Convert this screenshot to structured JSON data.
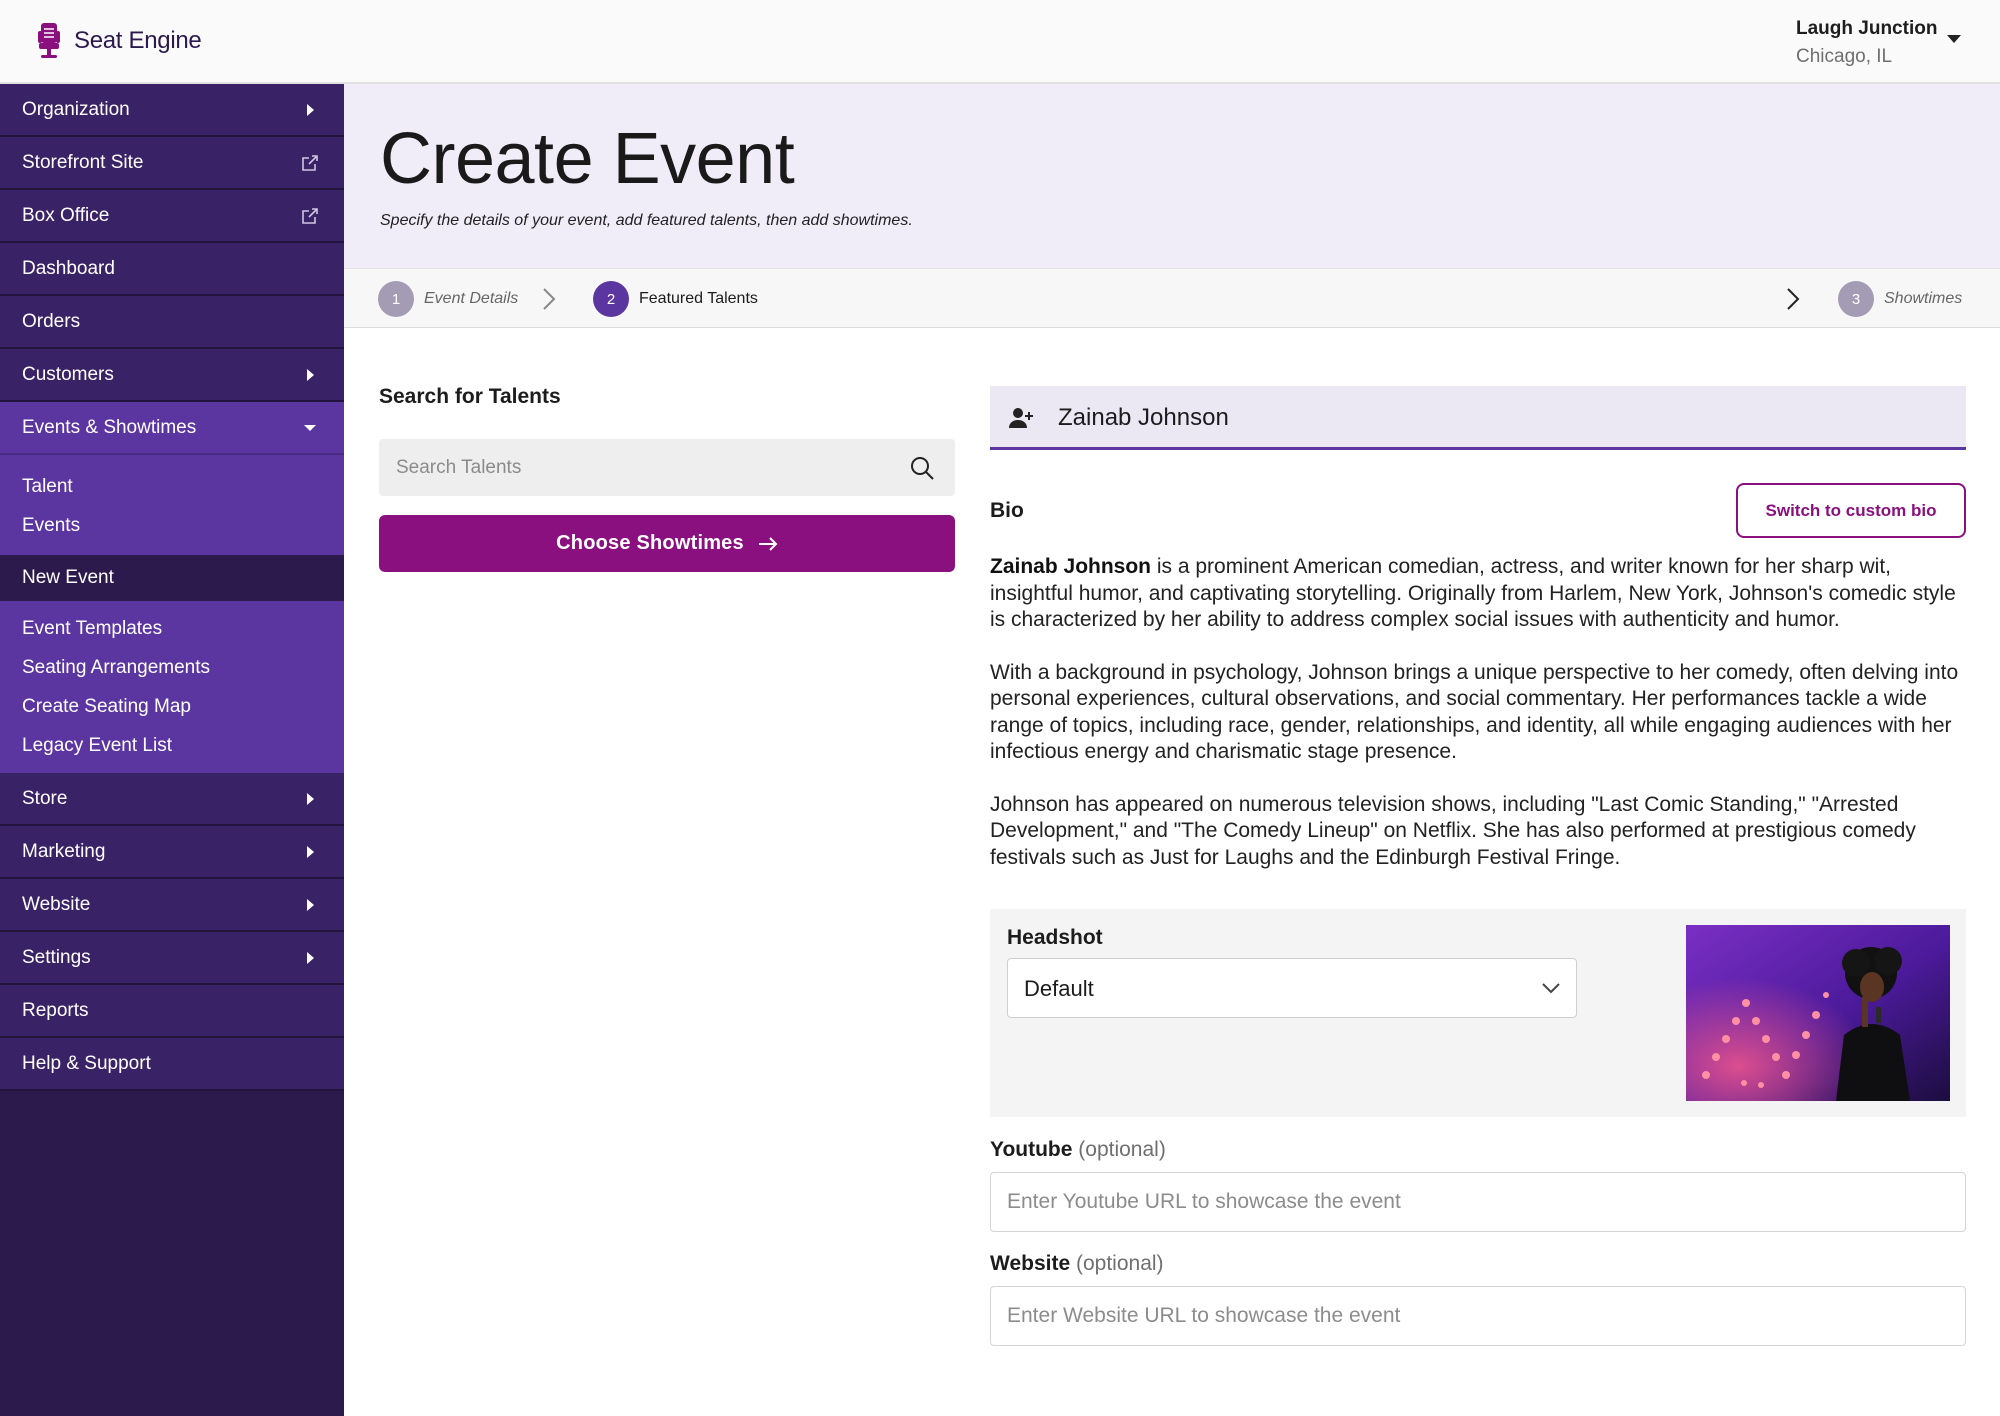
{
  "brand": {
    "name": "Seat Engine",
    "color": "#8a1080"
  },
  "venue": {
    "name": "Laugh Junction",
    "location": "Chicago, IL"
  },
  "sidebar": {
    "items": [
      {
        "label": "Organization",
        "icon": "caret-right-icon"
      },
      {
        "label": "Storefront Site",
        "icon": "external-link-icon"
      },
      {
        "label": "Box Office",
        "icon": "external-link-icon"
      },
      {
        "label": "Dashboard"
      },
      {
        "label": "Orders"
      },
      {
        "label": "Customers",
        "icon": "caret-right-icon"
      },
      {
        "label": "Events & Showtimes",
        "icon": "caret-down-icon",
        "expanded": true
      },
      {
        "label": "Store",
        "icon": "caret-right-icon"
      },
      {
        "label": "Marketing",
        "icon": "caret-right-icon"
      },
      {
        "label": "Website",
        "icon": "caret-right-icon"
      },
      {
        "label": "Settings",
        "icon": "caret-right-icon"
      },
      {
        "label": "Reports"
      },
      {
        "label": "Help & Support"
      }
    ],
    "events_subitems": [
      "Talent",
      "Events"
    ],
    "active_subitem": "New Event",
    "events_subitems_more": [
      "Event Templates",
      "Seating Arrangements",
      "Create Seating Map",
      "Legacy Event List"
    ]
  },
  "header": {
    "title": "Create Event",
    "subtitle": "Specify the details of your event, add featured talents, then add showtimes."
  },
  "stepper": {
    "steps": [
      {
        "number": "1",
        "label": "Event Details",
        "state": "inactive"
      },
      {
        "number": "2",
        "label": "Featured Talents",
        "state": "active"
      },
      {
        "number": "3",
        "label": "Showtimes",
        "state": "inactive"
      }
    ]
  },
  "search": {
    "title": "Search for Talents",
    "placeholder": "Search Talents",
    "choose_button": "Choose Showtimes"
  },
  "talent": {
    "name": "Zainab Johnson",
    "bio_label": "Bio",
    "custom_bio_button": "Switch to custom bio",
    "bio_name_bold": "Zainab Johnson",
    "bio_p1_rest": " is a prominent American comedian, actress, and writer known for her sharp wit, insightful humor, and captivating storytelling. Originally from Harlem, New York, Johnson's comedic style is characterized by her ability to address complex social issues with authenticity and humor.",
    "bio_p2": "With a background in psychology, Johnson brings a unique perspective to her comedy, often delving into personal experiences, cultural observations, and social commentary. Her performances tackle a wide range of topics, including race, gender, relationships, and identity, all while engaging audiences with her infectious energy and charismatic stage presence.",
    "bio_p3": "Johnson has appeared on numerous television shows, including \"Last Comic Standing,\" \"Arrested Development,\" and \"The Comedy Lineup\" on Netflix. She has also performed at prestigious comedy festivals such as Just for Laughs and the Edinburgh Festival Fringe.",
    "headshot_label": "Headshot",
    "headshot_value": "Default",
    "youtube_label": "Youtube",
    "youtube_optional": "(optional)",
    "youtube_placeholder": "Enter Youtube URL to showcase the event",
    "website_label": "Website",
    "website_optional": "(optional)",
    "website_placeholder": "Enter Website URL to showcase the event"
  },
  "colors": {
    "sidebar_bg": "#2c1a4d",
    "sidebar_item": "#3a2266",
    "sidebar_expanded": "#5b36a1",
    "accent_purple": "#5b36a1",
    "primary_button": "#8a1080",
    "header_bg": "#f0edf8"
  }
}
